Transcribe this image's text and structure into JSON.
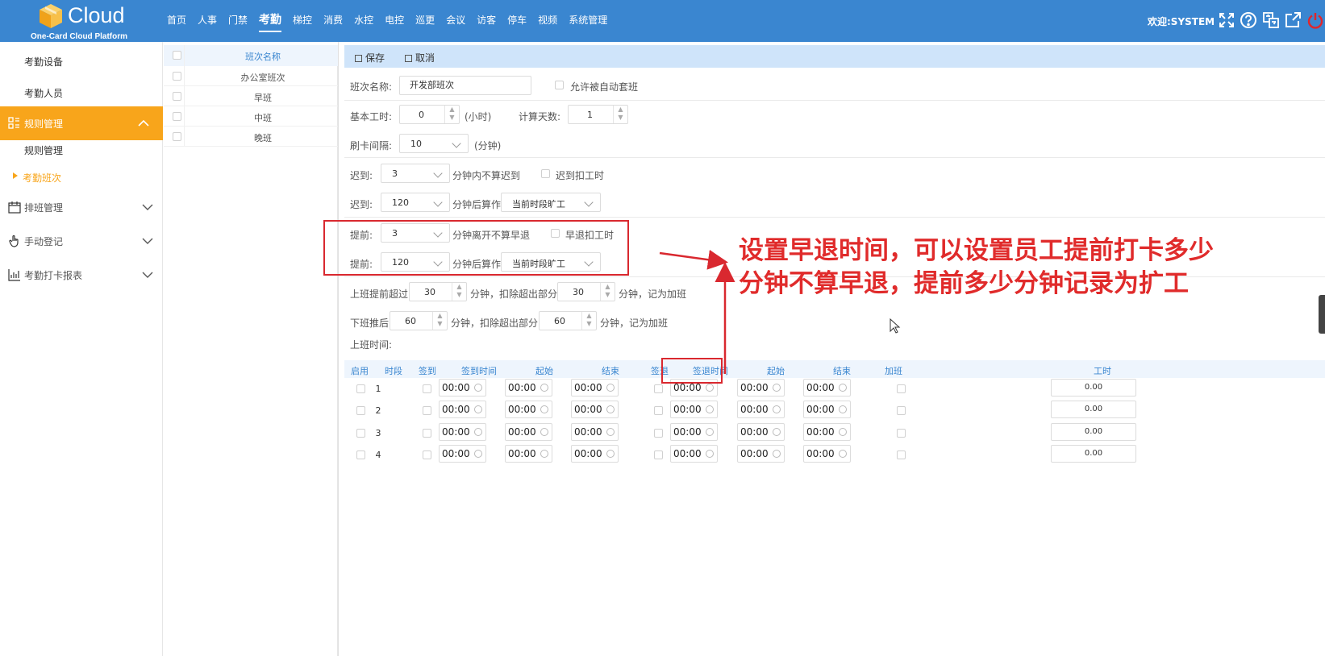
{
  "brand": {
    "name": "Cloud",
    "subtitle": "One-Card Cloud Platform"
  },
  "nav": [
    "首页",
    "人事",
    "门禁",
    "考勤",
    "梯控",
    "消费",
    "水控",
    "电控",
    "巡更",
    "会议",
    "访客",
    "停车",
    "视频",
    "系统管理"
  ],
  "nav_active": "考勤",
  "welcome": "欢迎:SYSTEM",
  "sidebar": {
    "items_top": [
      "考勤设备",
      "考勤人员"
    ],
    "active_group": "规则管理",
    "sub_items": [
      "规则管理",
      "考勤班次"
    ],
    "groups": [
      "排班管理",
      "手动登记",
      "考勤打卡报表"
    ]
  },
  "shift_list": {
    "header": "班次名称",
    "rows": [
      "办公室班次",
      "早班",
      "中班",
      "晚班"
    ]
  },
  "toolbar": {
    "save": "保存",
    "cancel": "取消"
  },
  "form": {
    "shift_name_label": "班次名称:",
    "shift_name_value": "开发部班次",
    "auto_apply_label": "允许被自动套班",
    "base_hours_label": "基本工时:",
    "base_hours_value": "0",
    "base_hours_unit": "(小时)",
    "calc_days_label": "计算天数:",
    "calc_days_value": "1",
    "swipe_interval_label": "刷卡间隔:",
    "swipe_interval_value": "10",
    "swipe_interval_unit": "(分钟)",
    "late1_label": "迟到:",
    "late1_value": "3",
    "late1_text": "分钟内不算迟到",
    "late_deduct_label": "迟到扣工时",
    "late2_label": "迟到:",
    "late2_value": "120",
    "late2_text": "分钟后算作",
    "late2_select": "当前时段旷工",
    "early1_label": "提前:",
    "early1_value": "3",
    "early1_text": "分钟离开不算早退",
    "early_deduct_label": "早退扣工时",
    "early2_label": "提前:",
    "early2_value": "120",
    "early2_text": "分钟后算作",
    "early2_select": "当前时段旷工",
    "ot_before_label": "上班提前超过",
    "ot_before_value": "30",
    "ot_before_text": "分钟，扣除超出部分",
    "ot_before_value2": "30",
    "ot_before_text2": "分钟，记为加班",
    "ot_after_label": "下班推后",
    "ot_after_value": "60",
    "ot_after_text": "分钟，扣除超出部分",
    "ot_after_value2": "60",
    "ot_after_text2": "分钟，记为加班",
    "work_time_label": "上班时间:"
  },
  "grid": {
    "headers": [
      "启用",
      "时段",
      "签到",
      "签到时间",
      "起始",
      "结束",
      "签退",
      "签退时间",
      "起始",
      "结束",
      "加班",
      "工时"
    ],
    "rows": [
      {
        "period": "1",
        "t1": "00:00",
        "t2": "00:00",
        "t3": "00:00",
        "t4": "00:00",
        "t5": "00:00",
        "t6": "00:00",
        "hours": "0.00"
      },
      {
        "period": "2",
        "t1": "00:00",
        "t2": "00:00",
        "t3": "00:00",
        "t4": "00:00",
        "t5": "00:00",
        "t6": "00:00",
        "hours": "0.00"
      },
      {
        "period": "3",
        "t1": "00:00",
        "t2": "00:00",
        "t3": "00:00",
        "t4": "00:00",
        "t5": "00:00",
        "t6": "00:00",
        "hours": "0.00"
      },
      {
        "period": "4",
        "t1": "00:00",
        "t2": "00:00",
        "t3": "00:00",
        "t4": "00:00",
        "t5": "00:00",
        "t6": "00:00",
        "hours": "0.00"
      }
    ]
  },
  "annotation": {
    "line1": "设置早退时间，可以设置员工提前打卡多少",
    "line2": "分钟不算早退，提前多少分钟记录为扩工",
    "color": "#e02b2b"
  },
  "colors": {
    "topbar": "#3a86d0",
    "accent": "#f8a51b",
    "header_text": "#3a86d0"
  }
}
